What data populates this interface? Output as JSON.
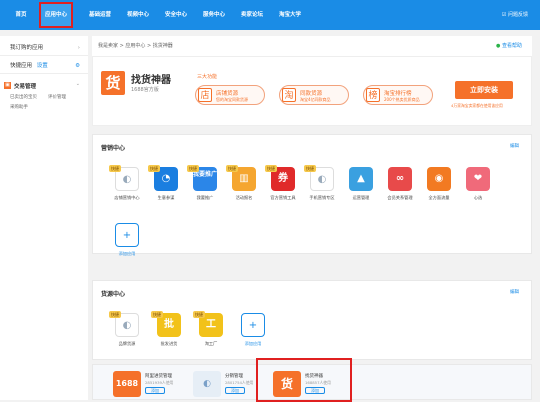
{
  "topnav": {
    "items": [
      {
        "label": "首页"
      },
      {
        "label": "应用中心"
      },
      {
        "label": "基础运营"
      },
      {
        "label": "视频中心"
      },
      {
        "label": "安全中心"
      },
      {
        "label": "服务中心"
      },
      {
        "label": "卖家论坛"
      },
      {
        "label": "淘宝大学"
      }
    ],
    "right_label": "问题反馈"
  },
  "sidebar": {
    "ordered_apps": "我订购的应用",
    "quick_apps": "快捷应用",
    "settings": "设置",
    "trade_manage": "交易管理",
    "sub1": "已卖出的宝贝",
    "sub2": "评价管理",
    "sub3": "采购助手"
  },
  "breadcrumb": {
    "path": "我是卖家 > 应用中心 > 找货神器",
    "help": "查看帮助"
  },
  "banner": {
    "logo_char": "货",
    "name": "找货神器",
    "sub": "1688官方版",
    "features_title": "三大功能",
    "features": [
      {
        "icon": "店",
        "title": "店铺货源",
        "desc": "您的淘宝同款货源"
      },
      {
        "icon": "淘",
        "title": "同款货源",
        "desc": "淘宝4亿同款商品"
      },
      {
        "icon": "榜",
        "title": "淘宝排行榜",
        "desc": "200个热卖优质商品"
      }
    ],
    "install_button": "立即安装",
    "install_note": "4万家淘宝卖家都在使用该应用"
  },
  "marketing": {
    "title": "营销中心",
    "edit": "编辑",
    "apps": [
      {
        "label": "店铺营销中心",
        "badge": "快捷",
        "icon": "◐",
        "color": "#ffffff"
      },
      {
        "label": "生意参谋",
        "badge": "快捷",
        "icon": "◔",
        "color": "#1a7ee0"
      },
      {
        "label": "我要推广",
        "badge": "快捷",
        "icon": "我要推广",
        "color": "#2b86e8"
      },
      {
        "label": "活动报名",
        "badge": "快捷",
        "icon": "▥",
        "color": "#f5a630"
      },
      {
        "label": "官方营销工具",
        "badge": "快捷",
        "icon": "券",
        "color": "#e02a2a"
      },
      {
        "label": "手机营销专区",
        "badge": "快捷",
        "icon": "◐",
        "color": "#ffffff"
      },
      {
        "label": "运营管理",
        "badge": "",
        "icon": "▲",
        "color": "#3aa0e0"
      },
      {
        "label": "会员关系管理",
        "badge": "",
        "icon": "∞",
        "color": "#e84a4a"
      },
      {
        "label": "全方面流量",
        "badge": "",
        "icon": "◉",
        "color": "#f27a22"
      },
      {
        "label": "心选",
        "badge": "",
        "icon": "❤",
        "color": "#f06a7a"
      }
    ],
    "add_label": "添加应用"
  },
  "sourcing": {
    "title": "货源中心",
    "edit": "编辑",
    "apps": [
      {
        "label": "品牌货源",
        "badge": "快捷",
        "icon": "◐",
        "color": "#ffffff"
      },
      {
        "label": "批发进货",
        "badge": "快捷",
        "icon": "批",
        "color": "#f2c21a"
      },
      {
        "label": "淘工厂",
        "badge": "快捷",
        "icon": "工",
        "color": "#f2c21a"
      }
    ],
    "add_label": "添加应用"
  },
  "recommend": [
    {
      "icon": "1688",
      "name": "阿里进货管理",
      "users": "2851939人使用",
      "btn": "添加",
      "color": "#f5712a"
    },
    {
      "icon": "◐",
      "name": "分销管理",
      "users": "2801754人使用",
      "btn": "添加",
      "color": "#e6eef6"
    },
    {
      "icon": "货",
      "name": "找货神器",
      "users": "168857人使用",
      "btn": "添加",
      "color": "#f5712a"
    }
  ]
}
